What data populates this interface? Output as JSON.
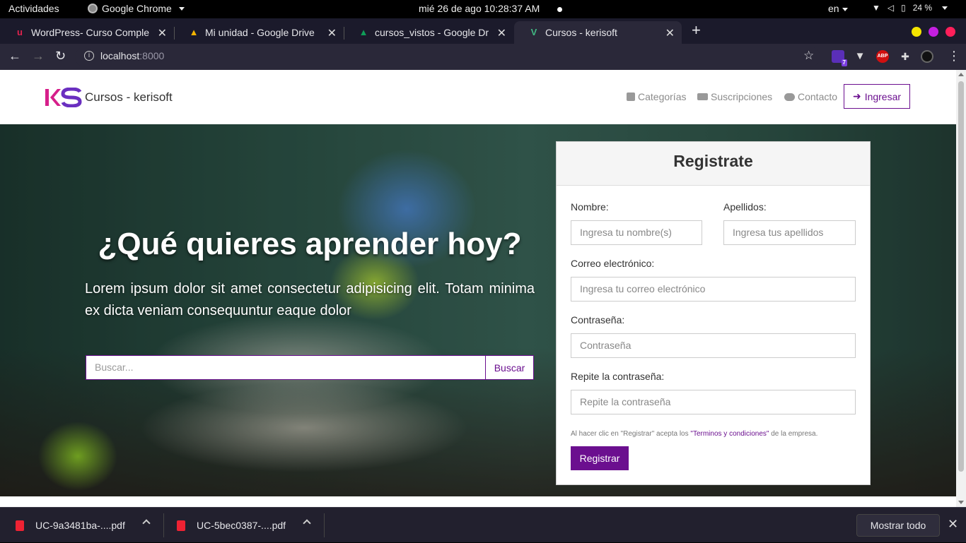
{
  "os": {
    "activities": "Actividades",
    "app_name": "Google Chrome",
    "clock": "mié 26 de ago  10:28:37 AM",
    "lang": "en",
    "battery": "24 %"
  },
  "tabs": [
    {
      "title": "WordPress- Curso Comple",
      "favicon": "udemy-icon",
      "active": false
    },
    {
      "title": "Mi unidad - Google Drive",
      "favicon": "drive-icon",
      "active": false
    },
    {
      "title": "cursos_vistos - Google Dr",
      "favicon": "drive-icon",
      "active": false
    },
    {
      "title": "Cursos - kerisoft",
      "favicon": "vue-icon",
      "active": true
    }
  ],
  "address": {
    "host": "localhost",
    "port": ":8000"
  },
  "extensions": {
    "badge": "7",
    "abp": "ABP"
  },
  "site": {
    "brand": "Cursos - kerisoft",
    "nav": {
      "categories": "Categorías",
      "subscriptions": "Suscripciones",
      "contact": "Contacto",
      "login": "Ingresar"
    },
    "hero": {
      "headline": "¿Qué quieres aprender hoy?",
      "lead": "Lorem ipsum dolor sit amet consectetur adipisicing elit. Totam minima ex dicta veniam consequuntur eaque dolor",
      "search_placeholder": "Buscar...",
      "search_button": "Buscar"
    },
    "register": {
      "title": "Registrate",
      "name_label": "Nombre:",
      "name_placeholder": "Ingresa tu nombre(s)",
      "lastname_label": "Apellidos:",
      "lastname_placeholder": "Ingresa tus apellidos",
      "email_label": "Correo electrónico:",
      "email_placeholder": "Ingresa tu correo electrónico",
      "password_label": "Contraseña:",
      "password_placeholder": "Contraseña",
      "repeat_label": "Repite la contraseña:",
      "repeat_placeholder": "Repite la contraseña",
      "terms_prefix": "Al hacer clic en \"Registrar\" acepta los ",
      "terms_link": "\"Terminos y condiciones\"",
      "terms_suffix": " de la empresa.",
      "submit": "Registrar"
    }
  },
  "downloads": {
    "items": [
      "UC-9a3481ba-....pdf",
      "UC-5bec0387-....pdf"
    ],
    "show_all": "Mostrar todo"
  },
  "colors": {
    "accent": "#6b0f8f",
    "chrome_bg": "#2a2839"
  }
}
